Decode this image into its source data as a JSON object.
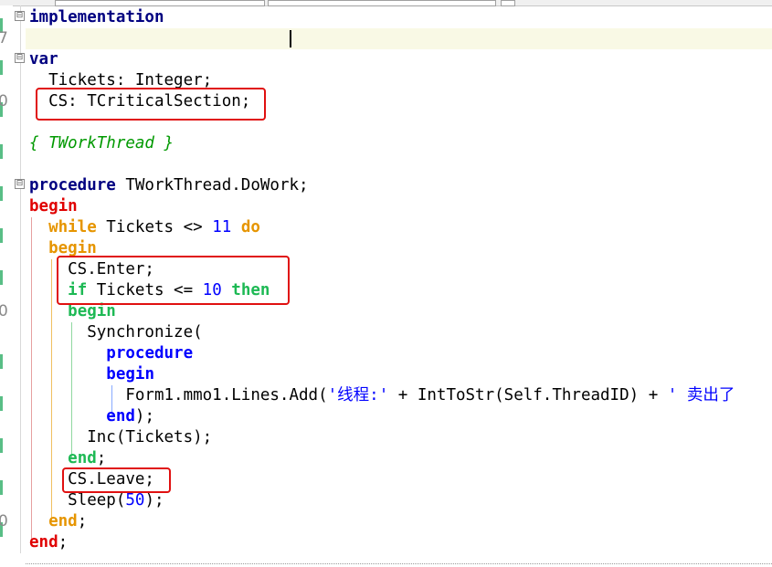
{
  "editor": {
    "gutter_numbers": [
      "7",
      "0",
      "0",
      "0"
    ],
    "fold_symbols": [
      "⊟",
      "⊟",
      "⊟"
    ],
    "lines": {
      "l1_kw": "implementation",
      "l3_kw": "var",
      "l4": "  Tickets: Integer;",
      "l5": "  CS: TCriticalSection;",
      "l7_comment": "{ TWorkThread }",
      "l9_kw": "procedure",
      "l9_rest": " TWorkThread.DoWork;",
      "l10_kw": "begin",
      "l11_indent": "  ",
      "l11_kw": "while",
      "l11_mid": " Tickets <> ",
      "l11_num": "11",
      "l11_kw2": "do",
      "l12_indent": "  ",
      "l12_kw": "begin",
      "l13": "    CS.Enter;",
      "l14_indent": "    ",
      "l14_kw": "if",
      "l14_mid": " Tickets <= ",
      "l14_num": "10",
      "l14_kw2": "then",
      "l15_indent": "    ",
      "l15_kw": "begin",
      "l16": "      Synchronize(",
      "l17_indent": "        ",
      "l17_kw": "procedure",
      "l18_indent": "        ",
      "l18_kw": "begin",
      "l19_a": "          Form1.mmo1.Lines.Add(",
      "l19_str": "'线程:'",
      "l19_b": " + IntToStr(Self.ThreadID) + ",
      "l19_str2": "' 卖出了",
      "l20_indent": "        ",
      "l20_kw": "end",
      "l20_rest": ");",
      "l21": "      Inc(Tickets);",
      "l22_indent": "    ",
      "l22_kw": "end",
      "l22_rest": ";",
      "l23": "    CS.Leave;",
      "l24_a": "    Sleep(",
      "l24_num": "50",
      "l24_b": ");",
      "l25_indent": "  ",
      "l25_kw": "end",
      "l25_rest": ";",
      "l26_kw": "end",
      "l26_rest": ";"
    }
  },
  "colors": {
    "keyword_navy": "#000080",
    "keyword_red": "#e00000",
    "keyword_orange": "#e69500",
    "keyword_green": "#1db954",
    "keyword_blue": "#0000ff",
    "highlight_box": "#e01010",
    "current_line": "#f9f9e5"
  }
}
